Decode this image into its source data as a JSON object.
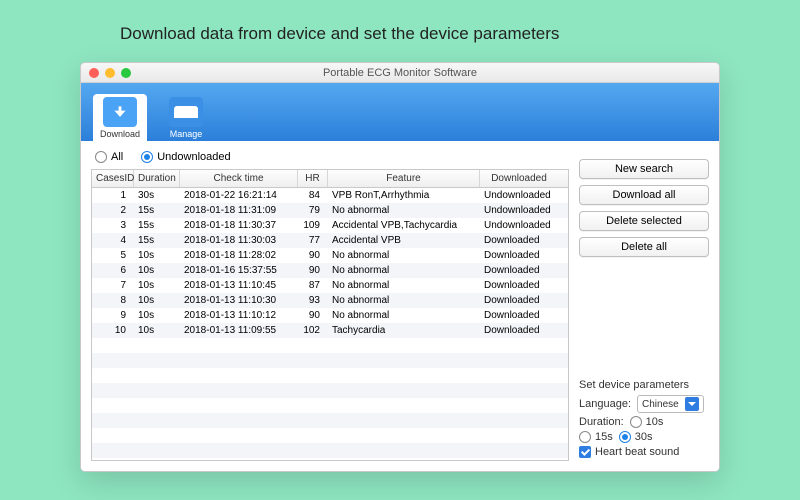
{
  "caption": "Download data from device and set the device parameters",
  "window_title": "Portable ECG Monitor Software",
  "tabs": {
    "download": "Download",
    "manage": "Manage"
  },
  "filter": {
    "all": "All",
    "undownloaded": "Undownloaded"
  },
  "columns": {
    "id": "CasesID",
    "duration": "Duration",
    "check": "Check time",
    "hr": "HR",
    "feature": "Feature",
    "downloaded": "Downloaded"
  },
  "rows": [
    {
      "id": "1",
      "dur": "30s",
      "check": "2018-01-22 16:21:14",
      "hr": "84",
      "feat": "VPB RonT,Arrhythmia",
      "dl": "Undownloaded"
    },
    {
      "id": "2",
      "dur": "15s",
      "check": "2018-01-18 11:31:09",
      "hr": "79",
      "feat": "No abnormal",
      "dl": "Undownloaded"
    },
    {
      "id": "3",
      "dur": "15s",
      "check": "2018-01-18 11:30:37",
      "hr": "109",
      "feat": "Accidental VPB,Tachycardia",
      "dl": "Undownloaded"
    },
    {
      "id": "4",
      "dur": "15s",
      "check": "2018-01-18 11:30:03",
      "hr": "77",
      "feat": "Accidental VPB",
      "dl": "Downloaded"
    },
    {
      "id": "5",
      "dur": "10s",
      "check": "2018-01-18 11:28:02",
      "hr": "90",
      "feat": "No abnormal",
      "dl": "Downloaded"
    },
    {
      "id": "6",
      "dur": "10s",
      "check": "2018-01-16 15:37:55",
      "hr": "90",
      "feat": "No abnormal",
      "dl": "Downloaded"
    },
    {
      "id": "7",
      "dur": "10s",
      "check": "2018-01-13 11:10:45",
      "hr": "87",
      "feat": "No abnormal",
      "dl": "Downloaded"
    },
    {
      "id": "8",
      "dur": "10s",
      "check": "2018-01-13 11:10:30",
      "hr": "93",
      "feat": "No abnormal",
      "dl": "Downloaded"
    },
    {
      "id": "9",
      "dur": "10s",
      "check": "2018-01-13 11:10:12",
      "hr": "90",
      "feat": "No abnormal",
      "dl": "Downloaded"
    },
    {
      "id": "10",
      "dur": "10s",
      "check": "2018-01-13 11:09:55",
      "hr": "102",
      "feat": "Tachycardia",
      "dl": "Downloaded"
    }
  ],
  "buttons": {
    "new_search": "New search",
    "download_all": "Download all",
    "delete_selected": "Delete selected",
    "delete_all": "Delete all"
  },
  "params": {
    "title": "Set device parameters",
    "language_label": "Language:",
    "language_value": "Chinese",
    "duration_label": "Duration:",
    "d10": "10s",
    "d15": "15s",
    "d30": "30s",
    "heartbeat": "Heart beat sound"
  }
}
